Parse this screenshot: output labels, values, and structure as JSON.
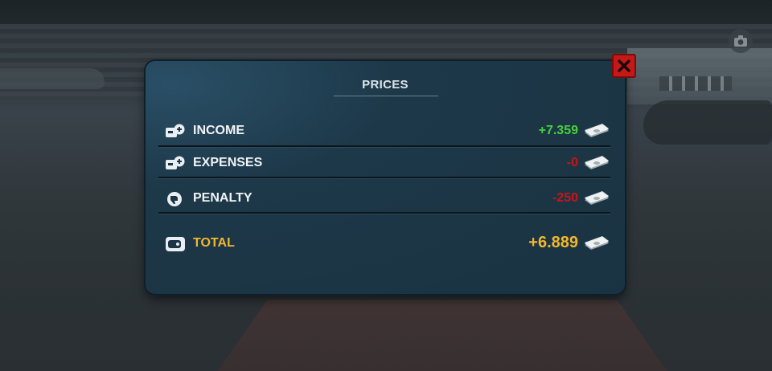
{
  "dialog": {
    "title": "PRICES",
    "rows": [
      {
        "label": "INCOME",
        "value": "+7.359",
        "icon": "coin-plus-icon"
      },
      {
        "label": "EXPENSES",
        "value": "-0",
        "icon": "coin-minus-icon"
      },
      {
        "label": "PENALTY",
        "value": "-250",
        "icon": "thumbs-down-icon"
      }
    ],
    "total": {
      "label": "TOTAL",
      "value": "+6.889",
      "icon": "wallet-icon"
    }
  },
  "colors": {
    "positive": "#46d23a",
    "negative": "#c91515",
    "total": "#f2b72d",
    "close_button": "#c41a17"
  }
}
